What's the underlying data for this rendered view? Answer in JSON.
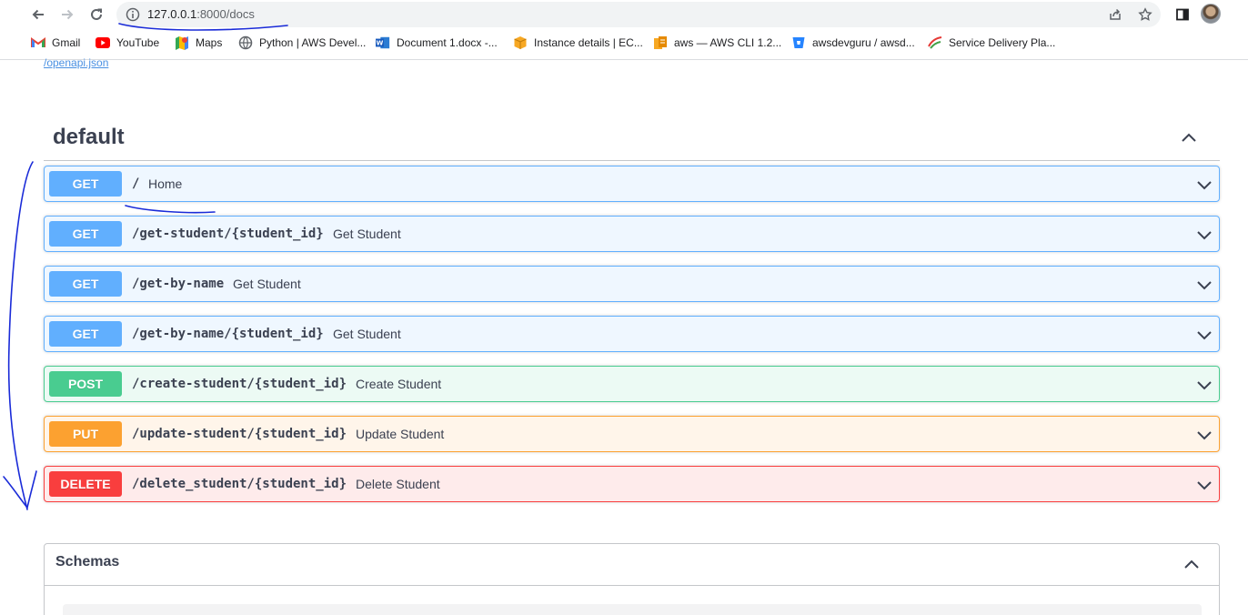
{
  "browser": {
    "url_host": "127.0.0.1",
    "url_path": ":8000/docs",
    "icons": [
      "back-icon",
      "forward-icon",
      "reload-icon",
      "site-info-icon",
      "share-icon",
      "bookmark-star-icon",
      "side-panel-icon",
      "profile-avatar"
    ]
  },
  "bookmarks": [
    {
      "label": "Gmail",
      "icon": "gmail-icon"
    },
    {
      "label": "YouTube",
      "icon": "youtube-icon"
    },
    {
      "label": "Maps",
      "icon": "maps-icon"
    },
    {
      "label": "Python | AWS Devel...",
      "icon": "globe-icon"
    },
    {
      "label": "Document 1.docx -...",
      "icon": "word-icon"
    },
    {
      "label": "Instance details | EC...",
      "icon": "aws-box-icon"
    },
    {
      "label": "aws — AWS CLI 1.2...",
      "icon": "aws-cli-icon"
    },
    {
      "label": "awsdevguru / awsd...",
      "icon": "bitbucket-icon"
    },
    {
      "label": "Service Delivery Pla...",
      "icon": "service-delivery-icon"
    }
  ],
  "swagger": {
    "openapi_link": "/openapi.json",
    "tag_title": "default",
    "colors": {
      "get": "#61affe",
      "post": "#49cc90",
      "put": "#fca130",
      "delete": "#f93e3e"
    },
    "operations": [
      {
        "method": "GET",
        "path": "/",
        "summary": "Home"
      },
      {
        "method": "GET",
        "path": "/get-student/{student_id}",
        "summary": "Get Student"
      },
      {
        "method": "GET",
        "path": "/get-by-name",
        "summary": "Get Student"
      },
      {
        "method": "GET",
        "path": "/get-by-name/{student_id}",
        "summary": "Get Student"
      },
      {
        "method": "POST",
        "path": "/create-student/{student_id}",
        "summary": "Create Student"
      },
      {
        "method": "PUT",
        "path": "/update-student/{student_id}",
        "summary": "Update Student"
      },
      {
        "method": "DELETE",
        "path": "/delete_student/{student_id}",
        "summary": "Delete Student"
      }
    ],
    "schemas_title": "Schemas"
  },
  "annotations": {
    "pen_color": "#1a2bd8"
  }
}
